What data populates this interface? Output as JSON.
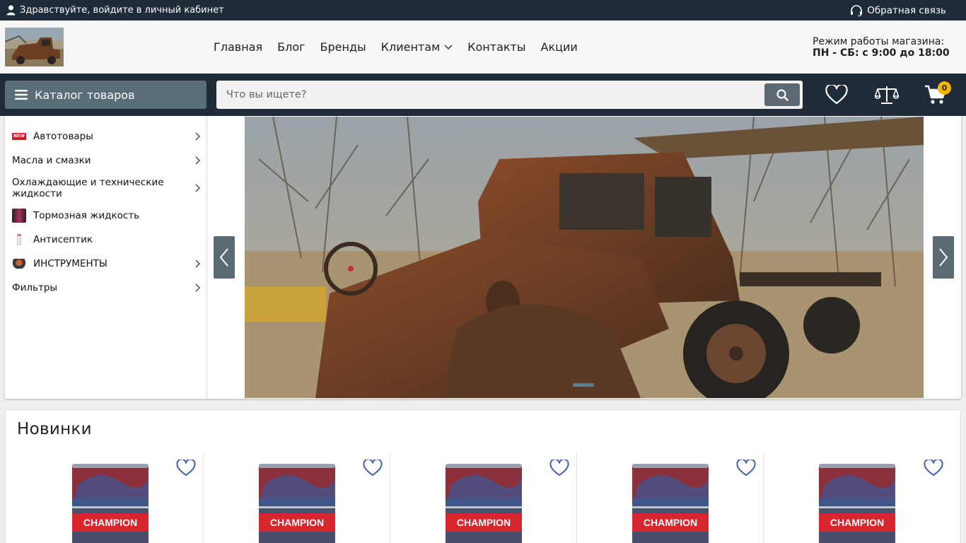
{
  "topbar": {
    "login_text": "Здравствуйте,  войдите в личный кабинет",
    "feedback_text": "Обратная связь"
  },
  "nav": {
    "items": [
      "Главная",
      "Блог",
      "Бренды",
      "Клиентам",
      "Контакты",
      "Акции"
    ]
  },
  "hours": {
    "line1": "Режим работы магазина:",
    "line2": "ПН - СБ: с 9:00 до 18:00"
  },
  "catalog": {
    "button_label": "Каталог товаров"
  },
  "search": {
    "placeholder": "Что вы ищете?",
    "value": ""
  },
  "cart": {
    "count": "0"
  },
  "categories": [
    {
      "label": "Автотовары",
      "icon": "new-badge-icon",
      "has_submenu": true
    },
    {
      "label": "Масла и смазки",
      "icon": "",
      "has_submenu": true
    },
    {
      "label": "Охлаждающие и технические жидкости",
      "icon": "",
      "has_submenu": true
    },
    {
      "label": "Тормозная жидкость",
      "icon": "brake-fluid-thumb",
      "has_submenu": false
    },
    {
      "label": "Антисептик",
      "icon": "antiseptic-thumb",
      "has_submenu": false
    },
    {
      "label": "ИНСТРУМЕНТЫ",
      "icon": "tools-thumb",
      "has_submenu": true
    },
    {
      "label": "Фильтры",
      "icon": "",
      "has_submenu": true
    }
  ],
  "new_arrivals": {
    "title": "Новинки",
    "products": [
      {
        "brand": "CHAMPION"
      },
      {
        "brand": "CHAMPION"
      },
      {
        "brand": "CHAMPION"
      },
      {
        "brand": "CHAMPION"
      },
      {
        "brand": "CHAMPION"
      }
    ]
  },
  "colors": {
    "dark_bar": "#1f2b38",
    "catalog_button": "#586d78",
    "badge": "#f2b500",
    "heart": "#3f5fb8"
  }
}
